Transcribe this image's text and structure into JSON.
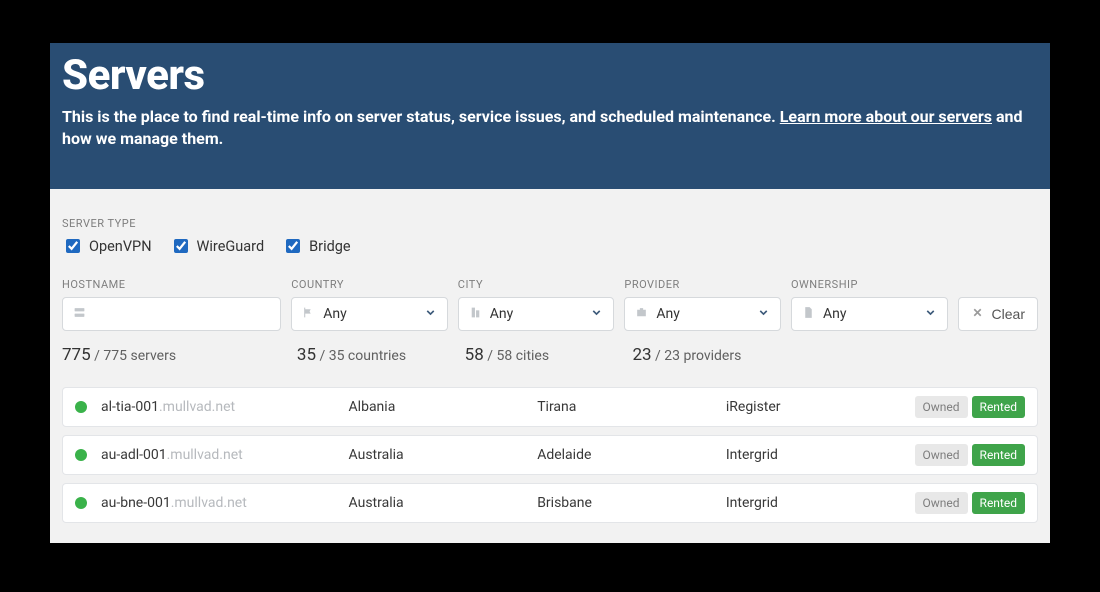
{
  "hero": {
    "title": "Servers",
    "desc_pre": "This is the place to find real-time info on server status, service issues, and scheduled maintenance. ",
    "link": "Learn more about our servers",
    "desc_post": " and how we manage them."
  },
  "filters": {
    "server_type_label": "Server type",
    "checkboxes": {
      "openvpn": "OpenVPN",
      "wireguard": "WireGuard",
      "bridge": "Bridge"
    },
    "columns": {
      "hostname": {
        "label": "Hostname",
        "value": ""
      },
      "country": {
        "label": "Country",
        "value": "Any"
      },
      "city": {
        "label": "City",
        "value": "Any"
      },
      "provider": {
        "label": "Provider",
        "value": "Any"
      },
      "ownership": {
        "label": "Ownership",
        "value": "Any"
      }
    },
    "clear": "Clear"
  },
  "stats": {
    "servers": {
      "count": "775",
      "total": " / 775 servers"
    },
    "countries": {
      "count": "35",
      "total": " / 35 countries"
    },
    "cities": {
      "count": "58",
      "total": " / 58 cities"
    },
    "providers": {
      "count": "23",
      "total": " / 23 providers"
    }
  },
  "common": {
    "domain_suffix": ".mullvad.net",
    "owned_label": "Owned",
    "rented_label": "Rented"
  },
  "rows": [
    {
      "hostname": "al-tia-001",
      "country": "Albania",
      "city": "Tirana",
      "provider": "iRegister",
      "owned": true,
      "rented": true
    },
    {
      "hostname": "au-adl-001",
      "country": "Australia",
      "city": "Adelaide",
      "provider": "Intergrid",
      "owned": true,
      "rented": true
    },
    {
      "hostname": "au-bne-001",
      "country": "Australia",
      "city": "Brisbane",
      "provider": "Intergrid",
      "owned": true,
      "rented": true
    }
  ]
}
